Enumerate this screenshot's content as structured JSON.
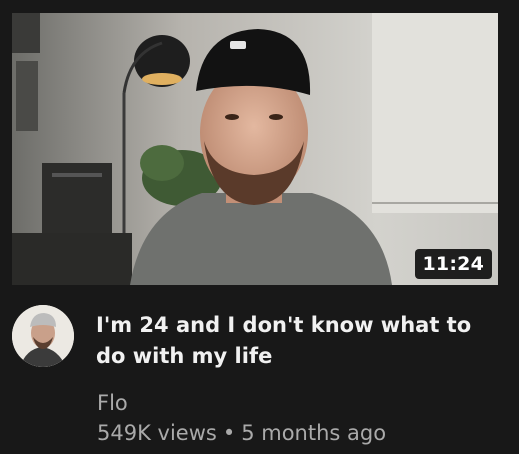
{
  "video": {
    "duration": "11:24",
    "title": "I'm 24 and I don't know what to do with my life",
    "channel": "Flo",
    "views": "549K views",
    "separator": "•",
    "age": "5 months ago"
  },
  "colors": {
    "background": "#181818",
    "title": "#f1f1f1",
    "meta": "#aaaaaa"
  }
}
